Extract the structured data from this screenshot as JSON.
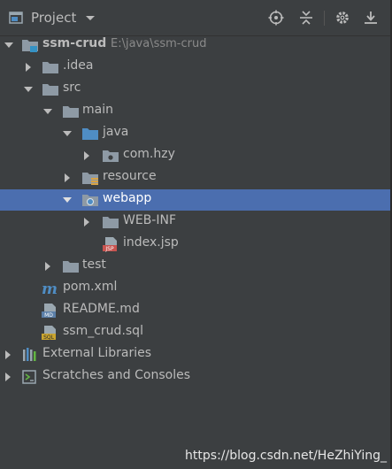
{
  "toolbar": {
    "title": "Project",
    "buttons": [
      "locate-icon",
      "collapse-all-icon",
      "gear-icon",
      "hide-icon"
    ]
  },
  "tree": {
    "root_label": "ssm-crud",
    "root_path": "E:\\java\\ssm-crud",
    "idea": ".idea",
    "src": "src",
    "main": "main",
    "java": "java",
    "package": "com.hzy",
    "resource": "resource",
    "webapp": "webapp",
    "webinf": "WEB-INF",
    "index": "index.jsp",
    "test": "test",
    "pom": "pom.xml",
    "readme": "README.md",
    "sql": "ssm_crud.sql",
    "libraries": "External Libraries",
    "scratches": "Scratches and Consoles"
  },
  "watermark": "https://blog.csdn.net/HeZhiYing_",
  "colors": {
    "background": "#3c3f41",
    "selection": "#4b6eaf",
    "text": "#bbbbbb",
    "folder": "#8e9aa5",
    "source_folder": "#4f8dc4"
  }
}
